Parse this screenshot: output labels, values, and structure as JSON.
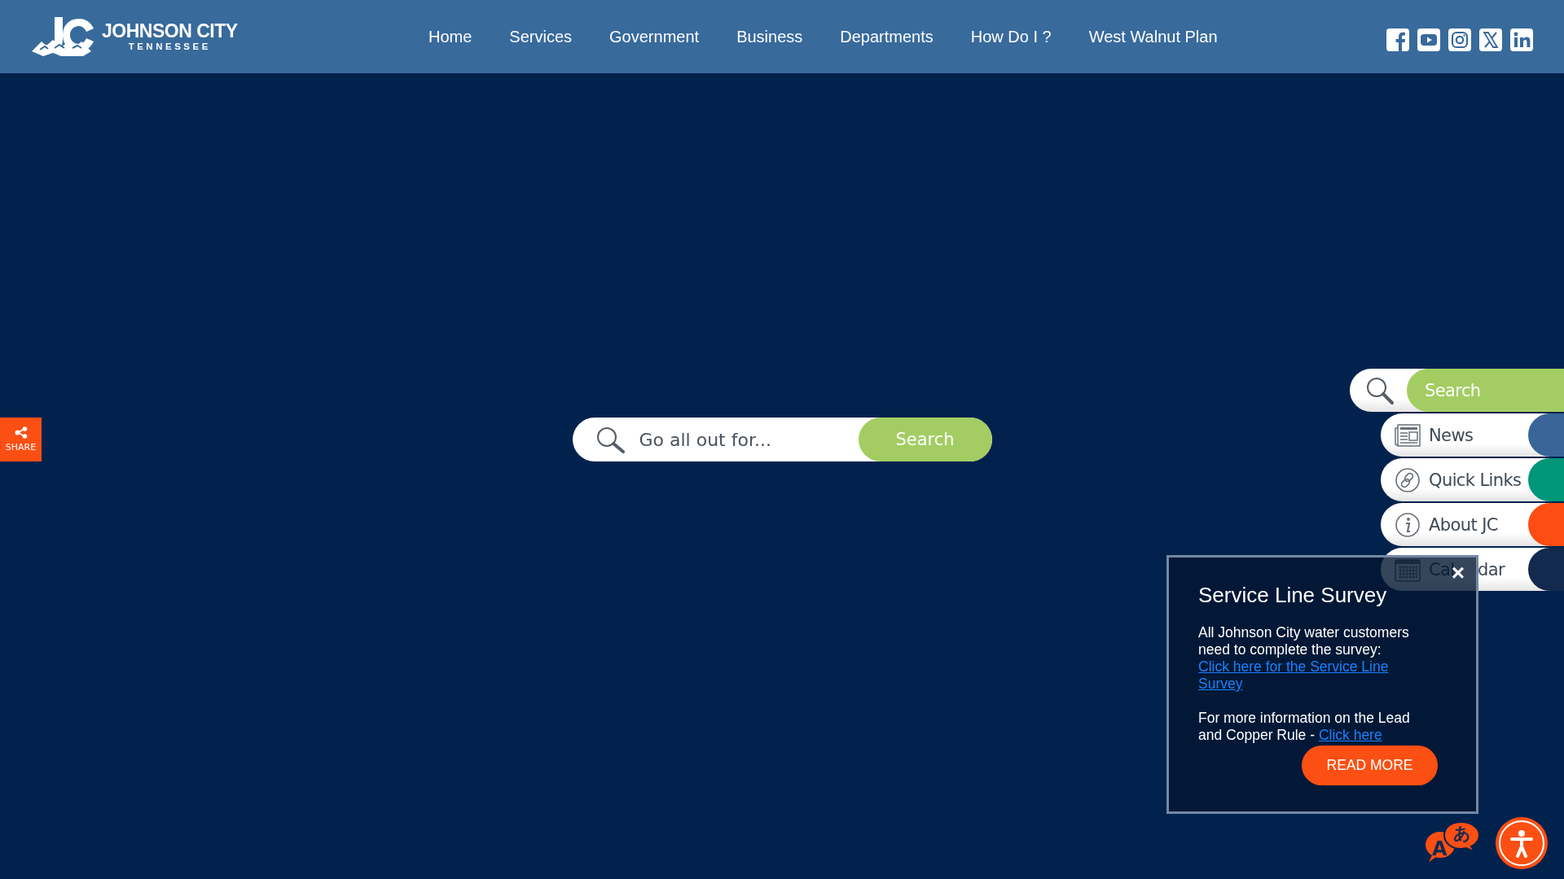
{
  "header": {
    "logo": {
      "name": "JOHNSON CITY",
      "subtitle": "TENNESSEE"
    },
    "nav": [
      {
        "label": "Home"
      },
      {
        "label": "Services"
      },
      {
        "label": "Government"
      },
      {
        "label": "Business"
      },
      {
        "label": "Departments"
      },
      {
        "label": "How Do I ?"
      },
      {
        "label": "West Walnut Plan"
      }
    ],
    "social": [
      {
        "kind": "facebook"
      },
      {
        "kind": "youtube"
      },
      {
        "kind": "instagram"
      },
      {
        "kind": "x"
      },
      {
        "kind": "linkedin"
      }
    ]
  },
  "share": {
    "label": "SHARE"
  },
  "hero_search": {
    "placeholder": "Go all out for...",
    "button": "Search"
  },
  "quick_panel": [
    {
      "kind": "search",
      "label": "Search",
      "color": "#a3cd62"
    },
    {
      "kind": "news",
      "label": "News",
      "color": "#3a6598"
    },
    {
      "kind": "links",
      "label": "Quick Links",
      "color": "#00967a"
    },
    {
      "kind": "about",
      "label": "About JC",
      "color": "#fd4d12"
    },
    {
      "kind": "calendar",
      "label": "Cal",
      "label_2": "dar",
      "color": "#13294e"
    }
  ],
  "popup": {
    "title": "Service Line Survey",
    "text_1": "All Johnson City water customers need to complete the survey:",
    "link_1": "Click here for the Service Line Survey",
    "text_2": "For more information on the Lead and Copper Rule - ",
    "link_2": "Click here",
    "close": "×",
    "button": "READ MORE"
  },
  "tools": {
    "translate": {
      "letter_a": "A",
      "letter_b": "あ"
    }
  }
}
